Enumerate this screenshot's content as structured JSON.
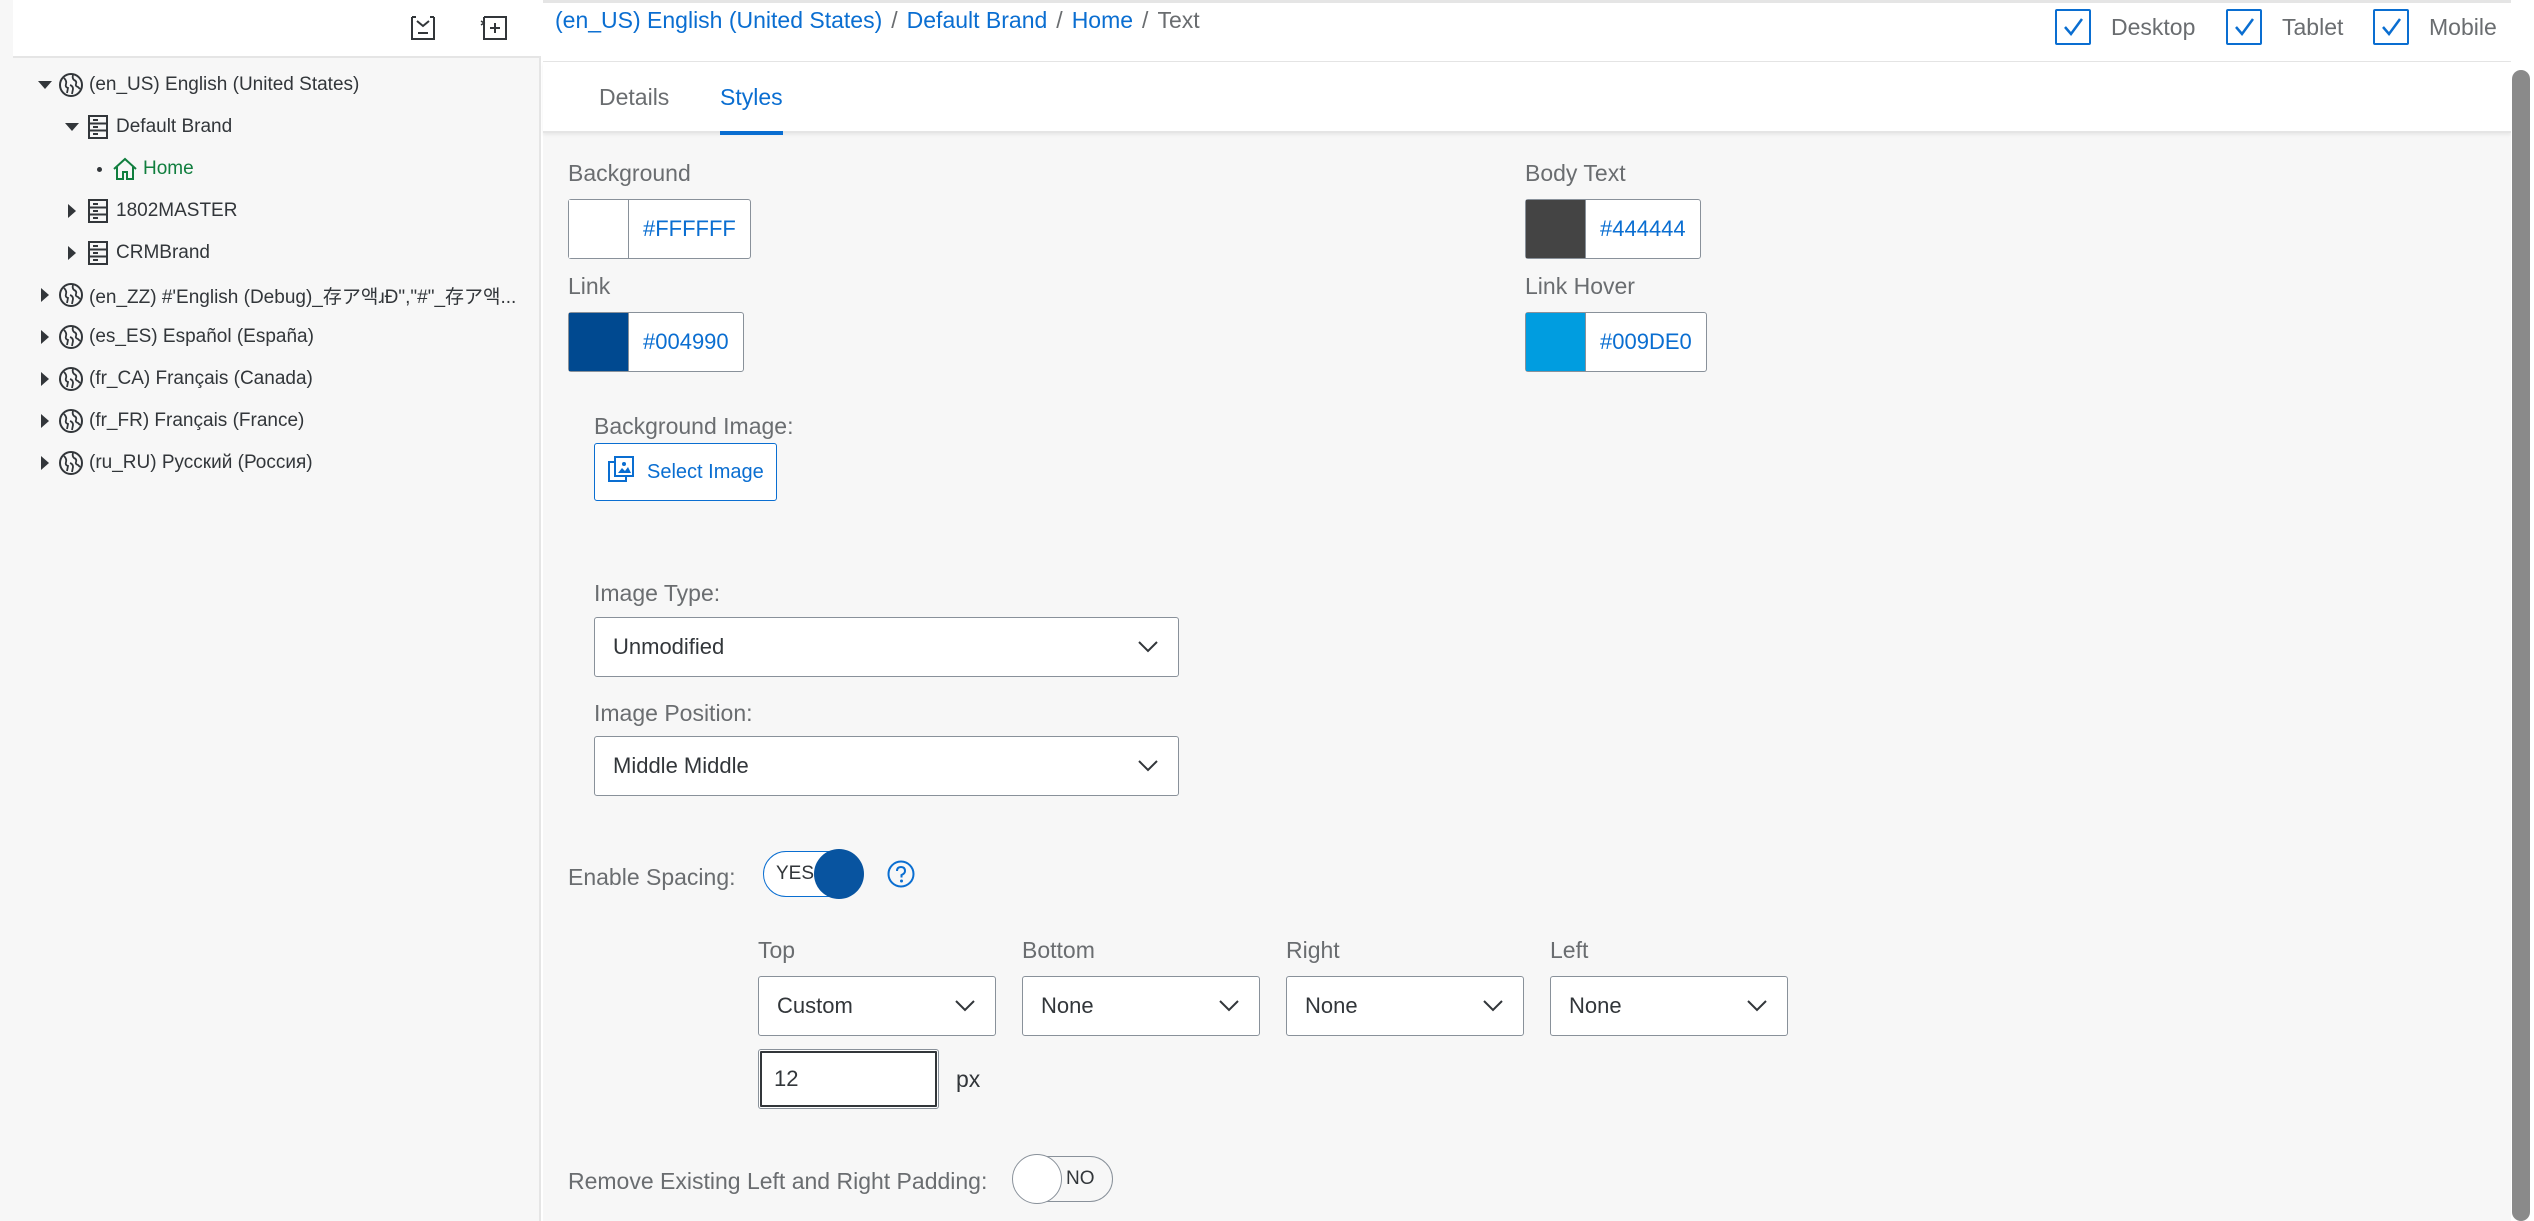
{
  "toolbar": {
    "collapse_icon": "collapse-all-icon",
    "expand_icon": "expand-all-icon"
  },
  "tree": [
    {
      "label": "(en_US) English (United States)",
      "icon": "globe-icon",
      "expander": "down"
    },
    {
      "label": "Default Brand",
      "icon": "server-icon",
      "expander": "down"
    },
    {
      "label": "Home",
      "icon": "home-icon",
      "expander": "bullet",
      "selected": true
    },
    {
      "label": "1802MASTER",
      "icon": "server-icon",
      "expander": "right"
    },
    {
      "label": "CRMBrand",
      "icon": "server-icon",
      "expander": "right"
    },
    {
      "label": "(en_ZZ) #'English (Debug)_存ア액ɹĐ\",\"#\"_存ア액...",
      "icon": "globe-icon",
      "expander": "right"
    },
    {
      "label": "(es_ES) Español (España)",
      "icon": "globe-icon",
      "expander": "right"
    },
    {
      "label": "(fr_CA) Français (Canada)",
      "icon": "globe-icon",
      "expander": "right"
    },
    {
      "label": "(fr_FR) Français (France)",
      "icon": "globe-icon",
      "expander": "right"
    },
    {
      "label": "(ru_RU) Русский (Россия)",
      "icon": "globe-icon",
      "expander": "right"
    }
  ],
  "breadcrumb": {
    "items": [
      "(en_US) English (United States)",
      "Default Brand",
      "Home"
    ],
    "separator": "/",
    "current": "Text"
  },
  "devices": [
    {
      "label": "Desktop",
      "checked": true
    },
    {
      "label": "Tablet",
      "checked": true
    },
    {
      "label": "Mobile",
      "checked": true
    }
  ],
  "tabs": [
    {
      "label": "Details",
      "active": false
    },
    {
      "label": "Styles",
      "active": true
    }
  ],
  "styles": {
    "background": {
      "label": "Background",
      "value": "#FFFFFF",
      "color": "#FFFFFF"
    },
    "body_text": {
      "label": "Body Text",
      "value": "#444444",
      "color": "#444444"
    },
    "link": {
      "label": "Link",
      "value": "#004990",
      "color": "#004990"
    },
    "link_hover": {
      "label": "Link Hover",
      "value": "#009DE0",
      "color": "#009DE0"
    },
    "background_image": {
      "label": "Background Image:",
      "button": "Select Image"
    },
    "image_type": {
      "label": "Image Type:",
      "value": "Unmodified"
    },
    "image_position": {
      "label": "Image Position:",
      "value": "Middle Middle"
    },
    "enable_spacing": {
      "label": "Enable Spacing:",
      "state": "YES"
    },
    "spacing": {
      "top": {
        "label": "Top",
        "value": "Custom"
      },
      "bottom": {
        "label": "Bottom",
        "value": "None"
      },
      "right": {
        "label": "Right",
        "value": "None"
      },
      "left": {
        "label": "Left",
        "value": "None"
      },
      "custom_value": "12",
      "unit": "px"
    },
    "remove_padding": {
      "label": "Remove Existing Left and Right Padding:",
      "state": "NO"
    }
  },
  "colors": {
    "accent": "#0a6ed1",
    "switch_knob": "#0854a0",
    "selected_tree": "#107e3e"
  }
}
